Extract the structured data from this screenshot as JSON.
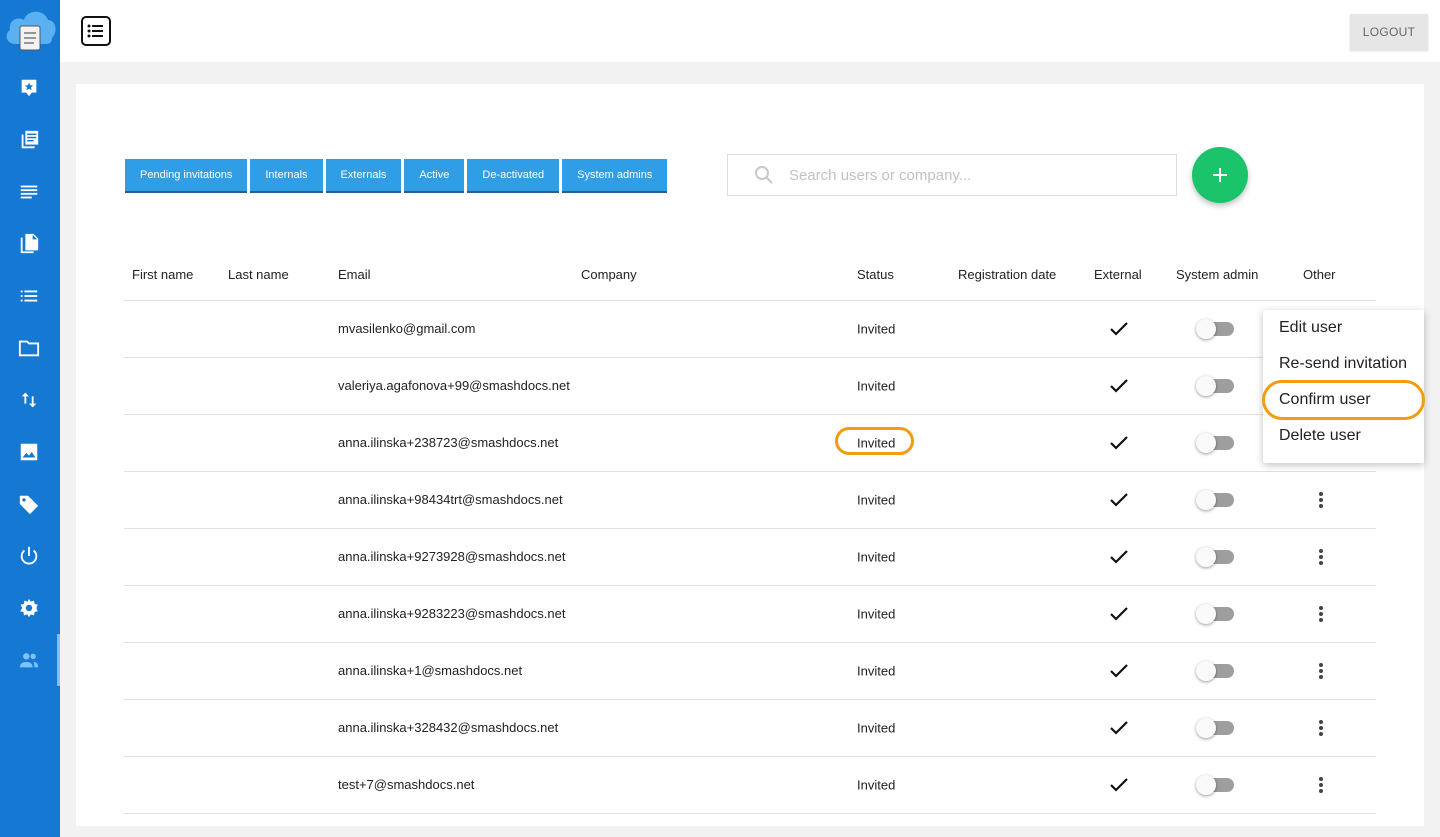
{
  "colors": {
    "sidebar": "#1578d3",
    "tab": "#2f9ee7",
    "fab": "#1bc46b",
    "highlight": "#f39c12"
  },
  "sidebar": {
    "items": [
      {
        "icon": "star-badge-icon"
      },
      {
        "icon": "documents-icon"
      },
      {
        "icon": "text-lines-icon"
      },
      {
        "icon": "copy-icon"
      },
      {
        "icon": "list-icon"
      },
      {
        "icon": "folder-icon"
      },
      {
        "icon": "sort-arrows-icon"
      },
      {
        "icon": "image-icon"
      },
      {
        "icon": "tag-icon"
      },
      {
        "icon": "power-icon"
      },
      {
        "icon": "gear-icon"
      },
      {
        "icon": "users-icon",
        "active": true
      }
    ]
  },
  "topbar": {
    "logout_label": "LOGOUT"
  },
  "tabs": [
    {
      "label": "Pending invitations"
    },
    {
      "label": "Internals"
    },
    {
      "label": "Externals"
    },
    {
      "label": "Active"
    },
    {
      "label": "De-activated"
    },
    {
      "label": "System admins"
    }
  ],
  "search": {
    "placeholder": "Search users or company..."
  },
  "table": {
    "headers": {
      "first_name": "First name",
      "last_name": "Last name",
      "email": "Email",
      "company": "Company",
      "status": "Status",
      "registration_date": "Registration date",
      "external": "External",
      "system_admin": "System admin",
      "other": "Other"
    },
    "rows": [
      {
        "email": "mvasilenko@gmail.com",
        "status": "Invited",
        "external": true,
        "system_admin": false
      },
      {
        "email": "valeriya.agafonova+99@smashdocs.net",
        "status": "Invited",
        "external": true,
        "system_admin": false
      },
      {
        "email": "anna.ilinska+238723@smashdocs.net",
        "status": "Invited",
        "external": true,
        "system_admin": false
      },
      {
        "email": "anna.ilinska+98434trt@smashdocs.net",
        "status": "Invited",
        "external": true,
        "system_admin": false
      },
      {
        "email": "anna.ilinska+9273928@smashdocs.net",
        "status": "Invited",
        "external": true,
        "system_admin": false
      },
      {
        "email": "anna.ilinska+9283223@smashdocs.net",
        "status": "Invited",
        "external": true,
        "system_admin": false
      },
      {
        "email": "anna.ilinska+1@smashdocs.net",
        "status": "Invited",
        "external": true,
        "system_admin": false
      },
      {
        "email": "anna.ilinska+328432@smashdocs.net",
        "status": "Invited",
        "external": true,
        "system_admin": false
      },
      {
        "email": "test+7@smashdocs.net",
        "status": "Invited",
        "external": true,
        "system_admin": false
      }
    ]
  },
  "context_menu": {
    "items": [
      {
        "label": "Edit user"
      },
      {
        "label": "Re-send invitation"
      },
      {
        "label": "Confirm user",
        "highlighted": true
      },
      {
        "label": "Delete user"
      }
    ]
  }
}
